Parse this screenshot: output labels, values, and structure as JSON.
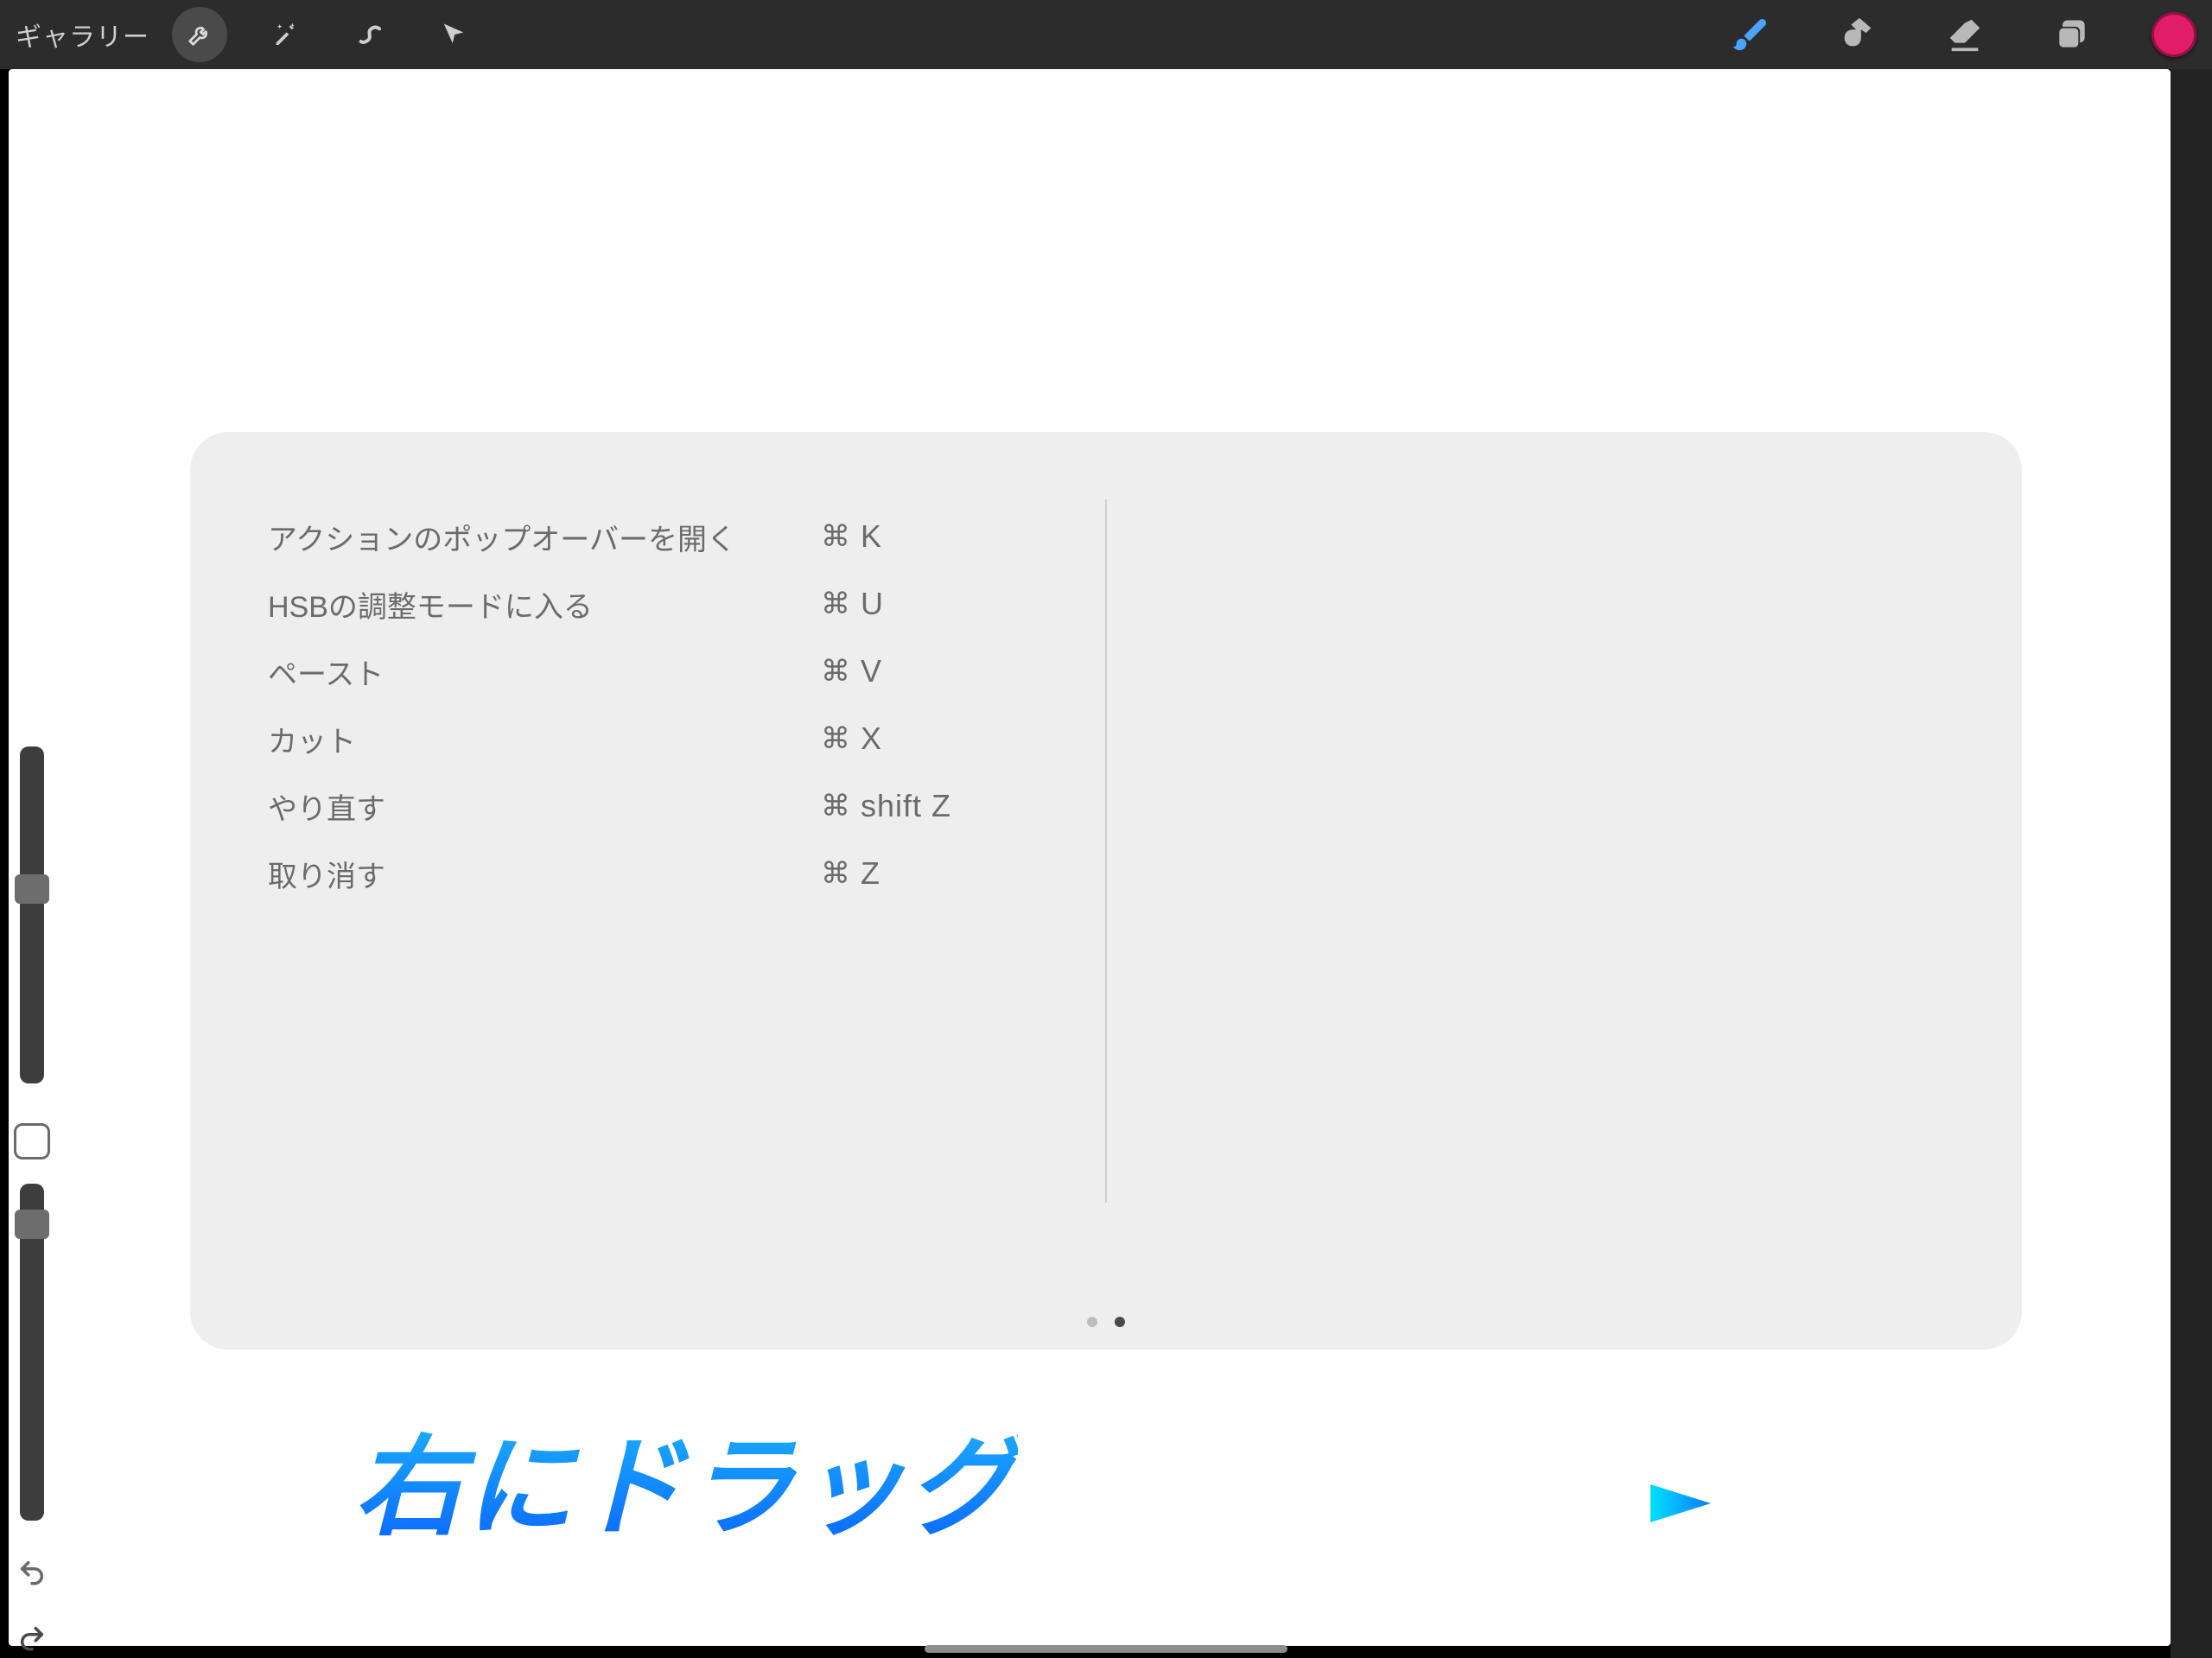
{
  "toolbar": {
    "gallery_label": "ギャラリー"
  },
  "panel": {
    "shortcuts": [
      {
        "label": "アクションのポップオーバーを開く",
        "mod": "⌘",
        "keys": "K"
      },
      {
        "label": "HSBの調整モードに入る",
        "mod": "⌘",
        "keys": "U"
      },
      {
        "label": "ペースト",
        "mod": "⌘",
        "keys": "V"
      },
      {
        "label": "カット",
        "mod": "⌘",
        "keys": "X"
      },
      {
        "label": "やり直す",
        "mod": "⌘",
        "keys": "shift Z"
      },
      {
        "label": "取り消す",
        "mod": "⌘",
        "keys": "Z"
      }
    ],
    "page_index": 1,
    "page_count": 2
  },
  "annotation": {
    "text": "右にドラッグ"
  },
  "colors": {
    "active_color": "#e11c69",
    "brush_accent": "#1e90ff"
  }
}
